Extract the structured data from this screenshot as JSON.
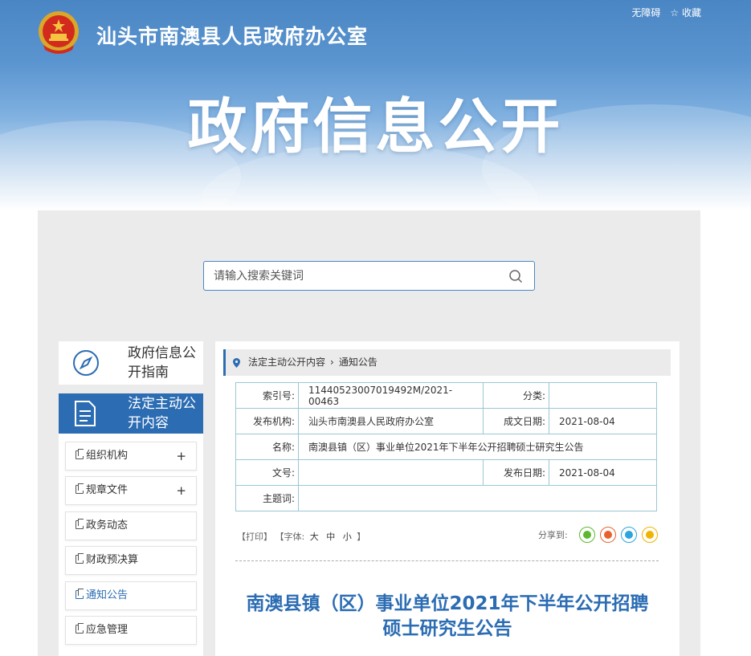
{
  "header": {
    "site_name": "汕头市南澳县人民政府办公室",
    "accessibility": "无障碍",
    "favorite": "收藏",
    "banner_title": "政府信息公开"
  },
  "search": {
    "placeholder": "请输入搜索关键词"
  },
  "sidebar": {
    "guide": "政府信息公开指南",
    "active": "法定主动公开内容",
    "items": [
      {
        "label": "组织机构",
        "expand": "+"
      },
      {
        "label": "规章文件",
        "expand": "+"
      },
      {
        "label": "政务动态"
      },
      {
        "label": "财政预决算"
      },
      {
        "label": "通知公告"
      },
      {
        "label": "应急管理"
      }
    ]
  },
  "breadcrumb": {
    "level1": "法定主动公开内容",
    "level2": "通知公告"
  },
  "meta": {
    "index_label": "索引号:",
    "index_value": "11440523007019492M/2021-00463",
    "category_label": "分类:",
    "category_value": "",
    "publisher_label": "发布机构:",
    "publisher_value": "汕头市南澳县人民政府办公室",
    "created_label": "成文日期:",
    "created_value": "2021-08-04",
    "name_label": "名称:",
    "name_value": "南澳县镇（区）事业单位2021年下半年公开招聘硕士研究生公告",
    "docno_label": "文号:",
    "docno_value": "",
    "pubdate_label": "发布日期:",
    "pubdate_value": "2021-08-04",
    "subject_label": "主题词:",
    "subject_value": ""
  },
  "tools": {
    "print": "【打印】",
    "font_label": "【字体:",
    "font_large": "大",
    "font_medium": "中",
    "font_small": "小",
    "font_end": "】",
    "share_label": "分享到:"
  },
  "colors": {
    "accent": "#2b6cb3",
    "wechat": "#5cb82e",
    "weibo": "#e8622c",
    "qq": "#2aa5e0",
    "qzone": "#f0b400"
  },
  "article": {
    "title_line1": "南澳县镇（区）事业单位2021年下半年公开招聘",
    "title_line2": "硕士研究生公告"
  }
}
